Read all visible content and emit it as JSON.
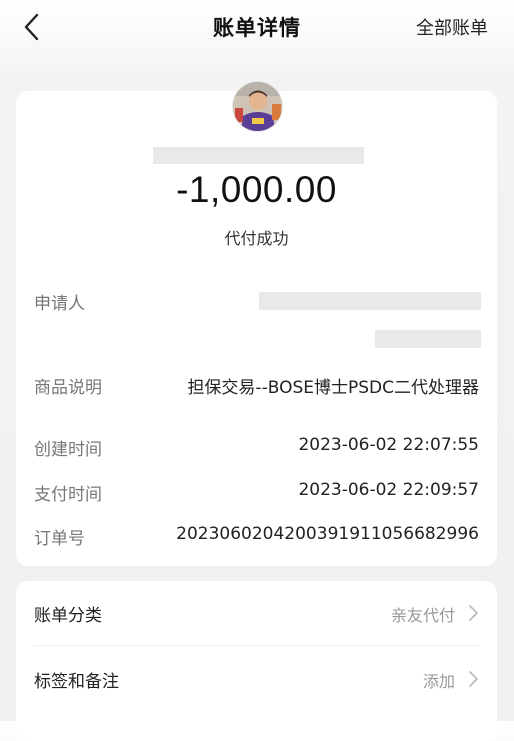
{
  "nav": {
    "title": "账单详情",
    "action": "全部账单"
  },
  "summary": {
    "amount": "-1,000.00",
    "status": "代付成功"
  },
  "details": {
    "applicant_label": "申请人",
    "product_label": "商品说明",
    "product_value": "担保交易--BOSE博士PSDC二代处理器",
    "created_label": "创建时间",
    "created_value": "2023-06-02 22:07:55",
    "paid_label": "支付时间",
    "paid_value": "2023-06-02 22:09:57",
    "order_label": "订单号",
    "order_value": "2023060204200391911056682996"
  },
  "list": {
    "category_label": "账单分类",
    "category_value": "亲友代付",
    "tags_label": "标签和备注",
    "tags_value": "添加"
  },
  "colors": {
    "background": "#f0f0f0",
    "card": "#ffffff",
    "text_primary": "#222222",
    "text_secondary": "#777777",
    "text_muted": "#999999",
    "skeleton": "#e9e9e9"
  },
  "icons": {
    "back": "chevron-left-icon",
    "row_arrow": "chevron-right-icon"
  }
}
